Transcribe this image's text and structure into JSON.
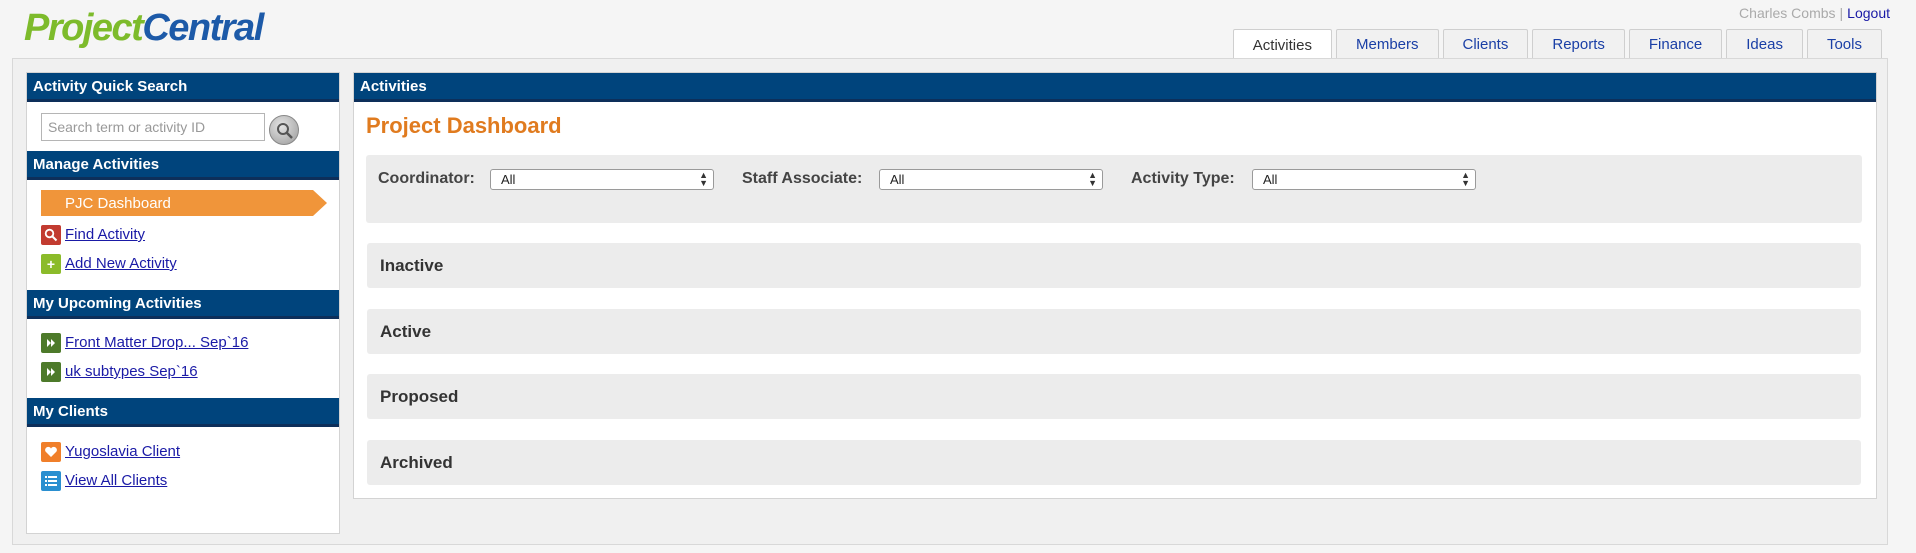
{
  "header": {
    "logo_part1": "Project",
    "logo_part2": "Central",
    "user_name": "Charles Combs",
    "separator": "|",
    "logout_label": "Logout"
  },
  "tabs": [
    {
      "label": "Activities",
      "active": true
    },
    {
      "label": "Members"
    },
    {
      "label": "Clients"
    },
    {
      "label": "Reports"
    },
    {
      "label": "Finance"
    },
    {
      "label": "Ideas"
    },
    {
      "label": "Tools"
    }
  ],
  "sidebar": {
    "quick_search": {
      "title": "Activity Quick Search",
      "placeholder": "Search term or activity ID",
      "icon": "search-icon"
    },
    "manage": {
      "title": "Manage Activities",
      "current": "PJC Dashboard",
      "items": [
        {
          "label": "Find Activity",
          "icon": "find-icon",
          "color": "#c23b30"
        },
        {
          "label": "Add New Activity",
          "icon": "add-icon",
          "color": "#8bbb2a"
        }
      ]
    },
    "upcoming": {
      "title": "My Upcoming Activities",
      "items": [
        {
          "label": "Front Matter Drop... Sep`16",
          "icon": "forward-icon",
          "color": "#4d7a2a"
        },
        {
          "label": "uk subtypes Sep`16",
          "icon": "forward-icon",
          "color": "#4d7a2a"
        }
      ]
    },
    "clients": {
      "title": "My Clients",
      "items": [
        {
          "label": "Yugoslavia Client",
          "icon": "heart-icon",
          "color": "#f07f2a"
        },
        {
          "label": "View All Clients",
          "icon": "list-icon",
          "color": "#2a8fd0"
        }
      ]
    }
  },
  "main": {
    "header": "Activities",
    "title": "Project Dashboard",
    "filters": [
      {
        "label": "Coordinator:",
        "value": "All"
      },
      {
        "label": "Staff Associate:",
        "value": "All"
      },
      {
        "label": "Activity Type:",
        "value": "All"
      }
    ],
    "sections": [
      "Inactive",
      "Active",
      "Proposed",
      "Archived"
    ]
  },
  "colors": {
    "header_blue": "#00447c",
    "accent_orange": "#e07b1f",
    "logo_green": "#7dbb2b",
    "logo_blue": "#1d5aa8"
  }
}
